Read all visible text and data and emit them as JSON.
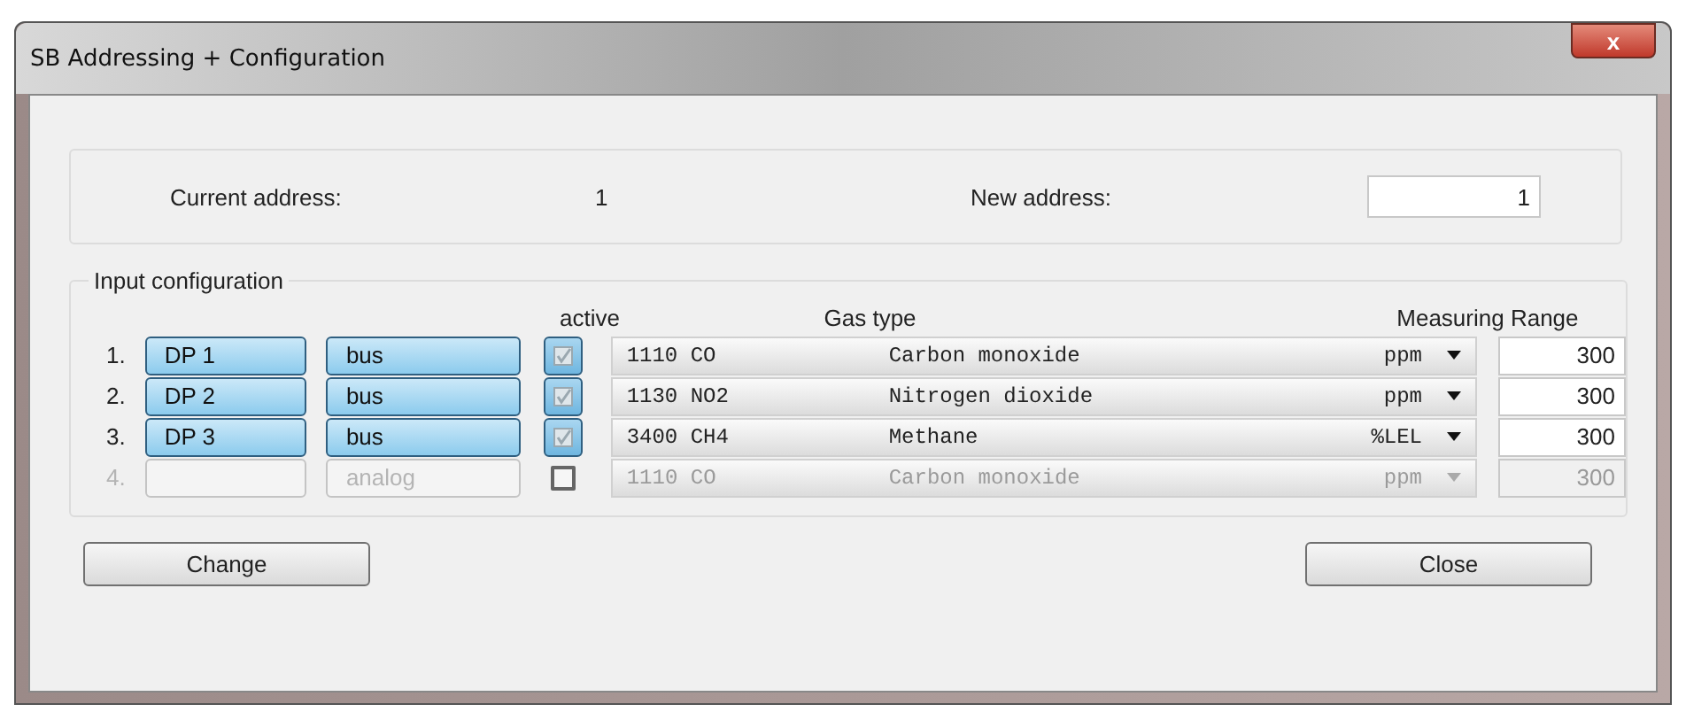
{
  "window": {
    "title": "SB Addressing + Configuration",
    "close_label": "x"
  },
  "address": {
    "current_label": "Current address:",
    "current_value": "1",
    "new_label": "New address:",
    "new_value": "1"
  },
  "input_configuration": {
    "title": "Input configuration",
    "headers": {
      "active": "active",
      "gas_type": "Gas type",
      "range": "Measuring Range"
    },
    "rows": [
      {
        "number": "1.",
        "name": "DP 1",
        "mode": "bus",
        "checked": true,
        "disabled": false,
        "code": "1110 CO",
        "gas": "Carbon monoxide",
        "unit": "ppm",
        "range": "300"
      },
      {
        "number": "2.",
        "name": "DP 2",
        "mode": "bus",
        "checked": true,
        "disabled": false,
        "code": "1130 NO2",
        "gas": "Nitrogen dioxide",
        "unit": "ppm",
        "range": "300"
      },
      {
        "number": "3.",
        "name": "DP 3",
        "mode": "bus",
        "checked": true,
        "disabled": false,
        "code": "3400 CH4",
        "gas": "Methane",
        "unit": "%LEL",
        "range": "300"
      },
      {
        "number": "4.",
        "mode": "analog",
        "checked": false,
        "disabled": true,
        "code": "1110 CO",
        "gas": "Carbon monoxide",
        "unit": "ppm",
        "range": "300"
      }
    ]
  },
  "buttons": {
    "change": "Change",
    "close": "Close"
  }
}
